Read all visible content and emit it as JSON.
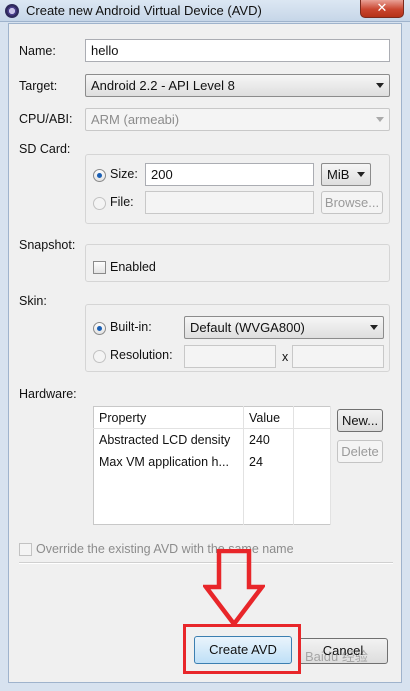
{
  "window": {
    "title": "Create new Android Virtual Device (AVD)",
    "close_glyph": "✕"
  },
  "form": {
    "name_label": "Name:",
    "name_value": "hello",
    "target_label": "Target:",
    "target_value": "Android 2.2 - API Level 8",
    "cpu_label": "CPU/ABI:",
    "cpu_value": "ARM (armeabi)",
    "sdcard_label": "SD Card:",
    "size_label": "Size:",
    "size_value": "200",
    "size_unit": "MiB",
    "file_label": "File:",
    "browse_label": "Browse...",
    "snapshot_label": "Snapshot:",
    "snapshot_enabled_label": "Enabled",
    "skin_label": "Skin:",
    "builtin_label": "Built-in:",
    "builtin_value": "Default (WVGA800)",
    "resolution_label": "Resolution:",
    "resolution_separator": "x",
    "hardware_label": "Hardware:",
    "hardware_columns": [
      "Property",
      "Value"
    ],
    "hardware_rows": [
      {
        "property": "Abstracted LCD density",
        "value": "240"
      },
      {
        "property": "Max VM application h...",
        "value": "24"
      }
    ],
    "new_button": "New...",
    "delete_button": "Delete",
    "override_label": "Override the existing AVD with the same name"
  },
  "buttons": {
    "create": "Create AVD",
    "cancel": "Cancel"
  },
  "overlay": {
    "arrow_color": "#e8262a",
    "highlight_color": "#e8262a",
    "watermark": "Baidu 经验"
  }
}
